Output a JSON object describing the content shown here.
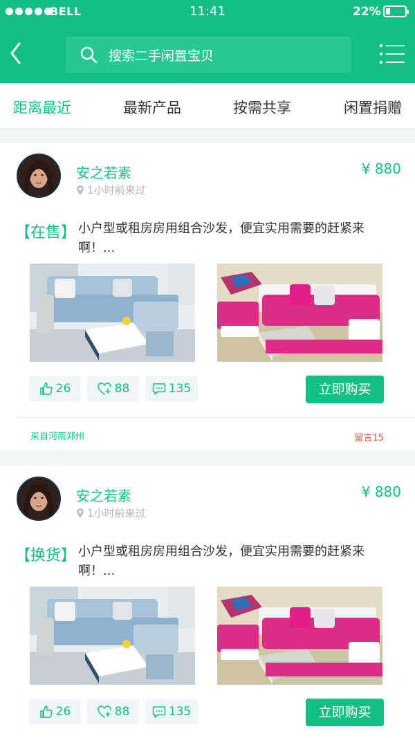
{
  "status_bar": {
    "carrier": "BELL",
    "time": "11:41",
    "battery_percent": "22%",
    "battery_level": 0.22
  },
  "header": {
    "search_placeholder": "搜索二手闲置宝贝"
  },
  "tabs": [
    {
      "label": "距离最近",
      "active": true
    },
    {
      "label": "最新产品",
      "active": false
    },
    {
      "label": "按需共享",
      "active": false
    },
    {
      "label": "闲置捐赠",
      "active": false
    }
  ],
  "posts": [
    {
      "user": "安之若素",
      "last_seen": "1小时前来过",
      "price": "¥ 880",
      "tag": "【在售】",
      "description": "小户型或租房房用组合沙发，便宜实用需要的赶紧来啊！...",
      "likes": "26",
      "favorites": "88",
      "comments": "135",
      "buy_label": "立即购买",
      "location": "来自河南郑州",
      "messages": "留言15"
    },
    {
      "user": "安之若素",
      "last_seen": "1小时前来过",
      "price": "¥ 880",
      "tag": "【换货】",
      "description": "小户型或租房房用组合沙发，便宜实用需要的赶紧来啊！...",
      "likes": "26",
      "favorites": "88",
      "comments": "135",
      "buy_label": "立即购买"
    }
  ],
  "colors": {
    "brand": "#14be86",
    "accent_red": "#e85a46"
  }
}
